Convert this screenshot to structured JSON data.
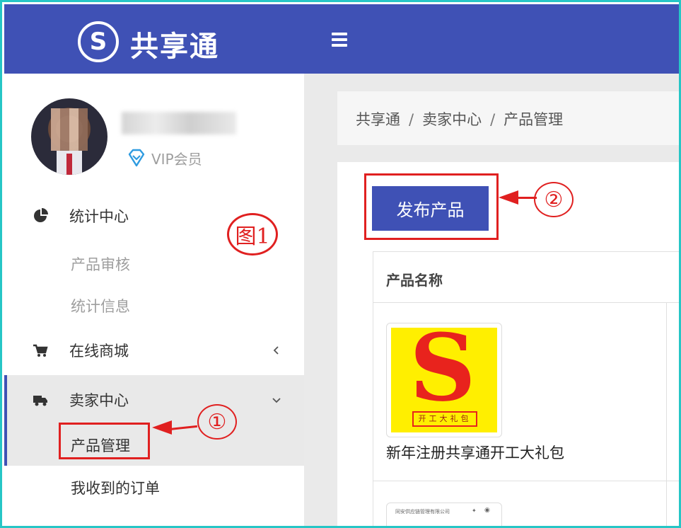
{
  "header": {
    "logo_glyph": "S",
    "app_name": "共享通",
    "brand_color": "#3f51b5"
  },
  "user": {
    "badge_label": "VIP会员"
  },
  "sidebar": {
    "items": [
      {
        "label": "统计中心",
        "icon": "pie-chart-icon",
        "expanded": true,
        "subitems": [
          {
            "label": "产品审核"
          },
          {
            "label": "统计信息"
          }
        ]
      },
      {
        "label": "在线商城",
        "icon": "cart-icon",
        "expanded": false
      },
      {
        "label": "卖家中心",
        "icon": "truck-icon",
        "expanded": true,
        "active": true,
        "subitems": [
          {
            "label": "产品管理",
            "active": true
          },
          {
            "label": "我收到的订单"
          }
        ]
      }
    ]
  },
  "breadcrumb": {
    "items": [
      "共享通",
      "卖家中心",
      "产品管理"
    ],
    "separator": "/"
  },
  "main": {
    "publish_button": "发布产品",
    "table": {
      "columns": [
        "产品名称"
      ],
      "rows": [
        {
          "product_name": "新年注册共享通开工大礼包",
          "thumbnail_letter": "S",
          "thumbnail_caption": "开工大礼包"
        }
      ],
      "partial_row_caption": "同安供应链管理有限公司"
    }
  },
  "annotations": {
    "figure_label": "图1",
    "step1": "①",
    "step2": "②",
    "color": "#e02020"
  }
}
